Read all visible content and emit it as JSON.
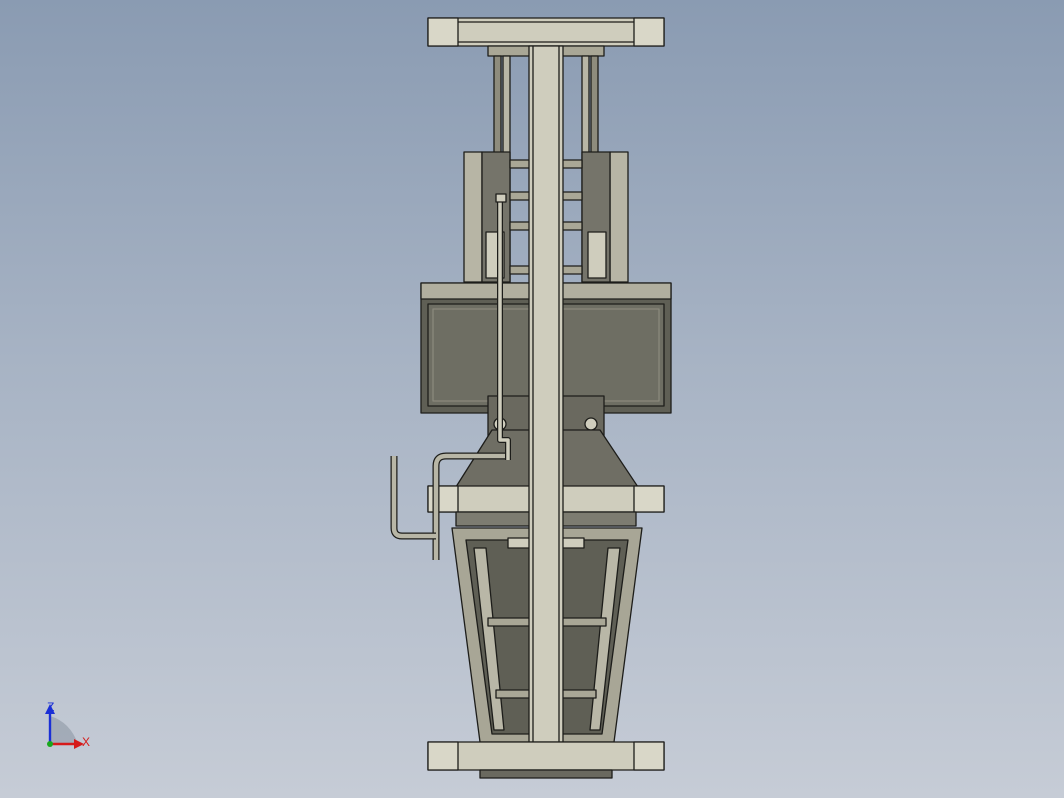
{
  "viewport": {
    "background_top": "#8a9bb2",
    "background_bottom": "#c6ccd6"
  },
  "model": {
    "fill_light": "#cfcdbd",
    "fill_mid": "#a9a796",
    "fill_dark": "#5f5f55",
    "panel_dark": "#6e6e63",
    "edge": "#1d1d1a"
  },
  "triad": {
    "z_label": "Z",
    "x_label": "X",
    "z_color": "#1a2fd6",
    "x_color": "#d61a1a",
    "y_color": "#19a81d",
    "icon": "coordinate-triad-icon"
  }
}
